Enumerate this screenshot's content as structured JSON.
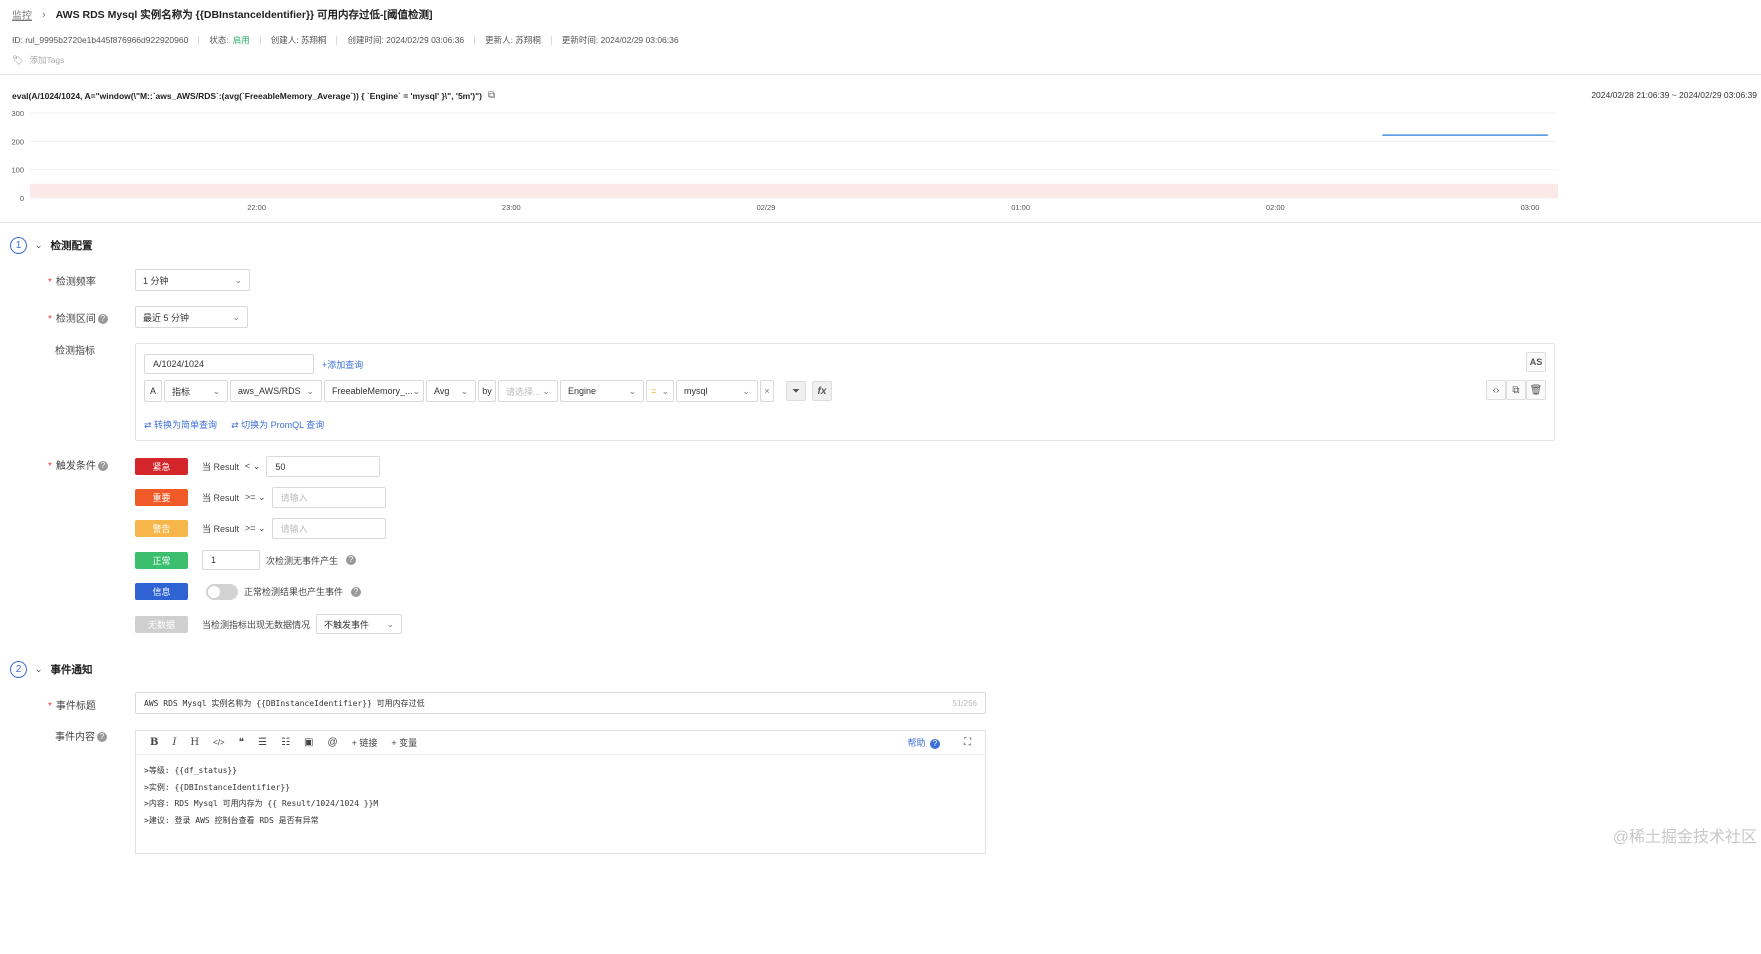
{
  "breadcrumb": {
    "root": "监控",
    "title": "AWS RDS Mysql 实例名称为 {{DBInstanceIdentifier}} 可用内存过低-[阈值检测]"
  },
  "meta": {
    "id": "ID: rul_9995b2720e1b445f876966d922920960",
    "status_label": "状态:",
    "status_value": "启用",
    "creator": "创建人: 苏翔桐",
    "created_at": "创建时间: 2024/02/29 03:06:36",
    "updater": "更新人: 苏翔桐",
    "updated_at": "更新时间: 2024/02/29 03:06:36",
    "add_tags": "添加Tags"
  },
  "chart_data": {
    "type": "line",
    "expression": "eval(A/1024/1024, A=\"window(\\\"M::`aws_AWS/RDS`:(avg(`FreeableMemory_Average`)) { `Engine` = 'mysql' }\\\", '5m')\")",
    "time_range": "2024/02/28 21:06:39 ~ 2024/02/29 03:06:39",
    "y_ticks": [
      "300",
      "200",
      "100",
      "0"
    ],
    "ylim": [
      0,
      300
    ],
    "x_ticks": [
      "22:00",
      "23:00",
      "02/29",
      "01:00",
      "02:00",
      "03:00"
    ],
    "x_tick_hours": [
      22,
      23,
      24,
      25,
      26,
      27
    ],
    "xlim": [
      21.11,
      27.11
    ],
    "series": [
      {
        "color": "#4a90e2",
        "x": [
          26.42,
          27.07
        ],
        "values": [
          222,
          222
        ]
      }
    ],
    "threshold_band": {
      "from": 0,
      "to": 50,
      "color": "#fde8e8"
    }
  },
  "section1": {
    "num": "1",
    "title": "检测配置",
    "freq_label": "检测频率",
    "freq_value": "1 分钟",
    "interval_label": "检测区间",
    "interval_value": "最近 5 分钟",
    "metric_label": "检测指标",
    "expr_input": "A/1024/1024",
    "add_query": "+添加查询",
    "as_btn": "AS",
    "query": {
      "letter": "A",
      "type": "指标",
      "namespace": "aws_AWS/RDS",
      "field": "FreeableMemory_...",
      "agg": "Avg",
      "by": "by",
      "by_placeholder": "请选择...",
      "filter_key": "Engine",
      "op": "=",
      "filter_value": "mysql",
      "clear": "×",
      "fx": "fx"
    },
    "switch_simple": "转换为简单查询",
    "switch_promql": "切换为 PromQL 查询",
    "trigger_label": "触发条件",
    "conditions": [
      {
        "level": "紧急",
        "color": "#d4262a",
        "text": "当 Result",
        "op": "<",
        "value": "50",
        "placeholder": ""
      },
      {
        "level": "重要",
        "color": "#f05a28",
        "text": "当 Result",
        "op": ">=",
        "value": "",
        "placeholder": "请输入"
      },
      {
        "level": "警告",
        "color": "#f6b64a",
        "text": "当 Result",
        "op": ">=",
        "value": "",
        "placeholder": "请输入"
      }
    ],
    "normal": {
      "level": "正常",
      "color": "#3bbf6e",
      "value": "1",
      "text": "次检测无事件产生"
    },
    "info": {
      "level": "信息",
      "color": "#2f63d3",
      "text": "正常检测结果也产生事件"
    },
    "nodata": {
      "level": "无数据",
      "color": "#cfcfcf",
      "text": "当检测指标出现无数据情况",
      "value": "不触发事件"
    }
  },
  "section2": {
    "num": "2",
    "title": "事件通知",
    "title_label": "事件标题",
    "title_value": "AWS RDS Mysql 实例名称为 {{DBInstanceIdentifier}} 可用内存过低",
    "title_count": "51/256",
    "content_label": "事件内容",
    "toolbar": {
      "bold": "B",
      "italic": "I",
      "heading": "H",
      "code": "</>",
      "quote": "❝",
      "ul": "☰",
      "ol": "☷",
      "image": "▣",
      "mention": "@",
      "link": "+ 链接",
      "var": "+ 变量",
      "help": "帮助",
      "fullscreen": "⛶"
    },
    "lines": [
      ">等级: {{df_status}}",
      ">实例: {{DBInstanceIdentifier}}",
      ">内容: RDS Mysql 可用内存为 {{ Result/1024/1024 }}M",
      ">建议: 登录 AWS 控制台查看 RDS 是否有异常"
    ]
  },
  "watermark": "@稀土掘金技术社区"
}
